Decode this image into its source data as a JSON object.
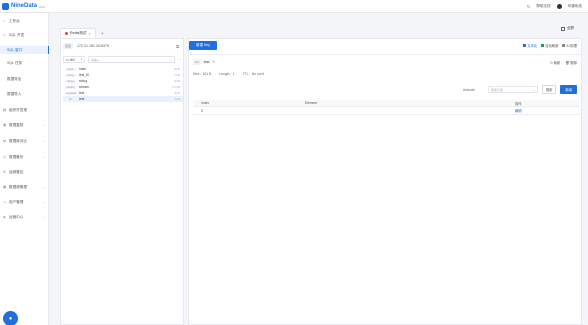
{
  "app": {
    "brand": "NineData",
    "brand_sub": "Web"
  },
  "topbar": {
    "help_label": "帮助文档",
    "user_label": "印康系统",
    "help_icon": "help-icon",
    "refresh_icon": "refresh-icon"
  },
  "sidebar": {
    "items": [
      {
        "label": "工作台",
        "icon": "home-icon"
      },
      {
        "label": "SQL 开发",
        "icon": "code-icon"
      },
      {
        "label": "SQL 窗口",
        "icon": "",
        "sub": true,
        "active": true
      },
      {
        "label": "SQL 任务",
        "icon": "",
        "sub": true
      },
      {
        "label": "数据导出",
        "icon": "",
        "sub": true
      },
      {
        "label": "数据导入",
        "icon": "",
        "sub": true
      },
      {
        "label": "组织开发规",
        "icon": "org-icon"
      },
      {
        "label": "数据复制",
        "icon": "copy-icon"
      },
      {
        "label": "数据库对比",
        "icon": "compare-icon"
      },
      {
        "label": "数据备份",
        "icon": "backup-icon"
      },
      {
        "label": "运维管控",
        "icon": "ops-icon"
      },
      {
        "label": "数据源管理",
        "icon": "datasource-icon"
      },
      {
        "label": "用户管理",
        "icon": "user-icon"
      },
      {
        "label": "运营中心",
        "icon": "center-icon"
      }
    ]
  },
  "tabs": {
    "items": [
      {
        "label": "Redis测试"
      }
    ],
    "fullscreen_label": "全屏"
  },
  "left_panel": {
    "conn_badge": "连接",
    "connection": "172.21.181.20:6379",
    "db": "db0",
    "search_placeholder": "请输入",
    "keys": [
      {
        "type": "hash",
        "name": "hash",
        "size": "80 B"
      },
      {
        "type": "string",
        "name": "test_ttl",
        "size": "72 B"
      },
      {
        "type": "string",
        "name": "string",
        "size": "64 B"
      },
      {
        "type": "stream",
        "name": "stream",
        "size": "2.1 KB"
      },
      {
        "type": "zset/rank",
        "name": "test",
        "size": "91 B"
      },
      {
        "type": "list",
        "name": "test",
        "size": "72 B",
        "selected": true
      }
    ]
  },
  "right_panel": {
    "new_button": "新建 Key",
    "toolbar": [
      {
        "label": "文本化",
        "color": "#1f6fe0"
      },
      {
        "label": "自动刷新",
        "color": "#1e9e5a"
      },
      {
        "label": "AI 助理",
        "color": "#888888"
      }
    ],
    "key_type": "list",
    "key_name": "test",
    "actions": [
      "刷新",
      "删除"
    ],
    "meta": {
      "size": "Size：161 B",
      "length": "Length：1",
      "ttl": "TTL：No Limit"
    },
    "search_label": "Unicode",
    "search_placeholder": "搜索元素",
    "search_button": "搜索",
    "add_button": "新增",
    "table": {
      "headers": [
        "Index",
        "Element",
        "操作"
      ],
      "rows": [
        {
          "index": "0",
          "element": "",
          "op": "编辑"
        }
      ]
    }
  }
}
